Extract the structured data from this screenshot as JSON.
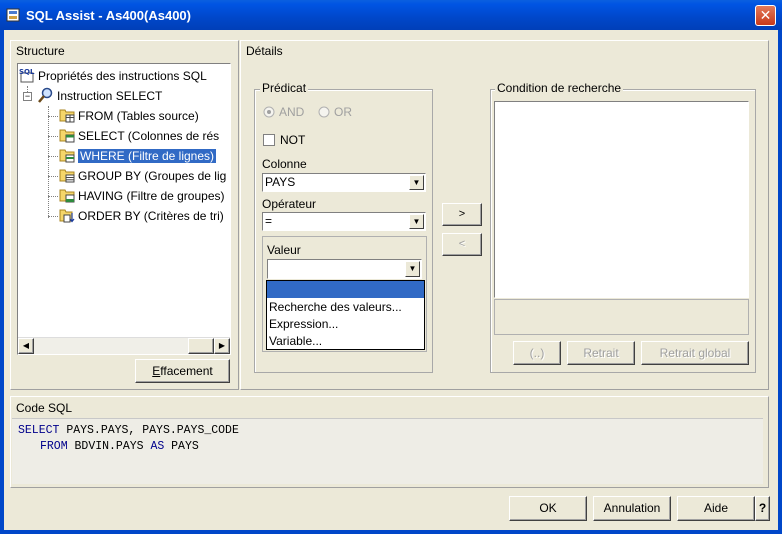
{
  "window": {
    "title": "SQL Assist - As400(As400)",
    "close_glyph": "✕"
  },
  "structure": {
    "label": "Structure",
    "tree": [
      {
        "label": "Propriétés des instructions SQL",
        "icon": "sql-icon"
      },
      {
        "label": "Instruction SELECT",
        "icon": "magnifier-icon"
      },
      {
        "label": "FROM (Tables source)",
        "icon": "folder-table-icon"
      },
      {
        "label": "SELECT (Colonnes de rés",
        "icon": "folder-table-icon"
      },
      {
        "label": "WHERE (Filtre de lignes)",
        "icon": "folder-table-icon"
      },
      {
        "label": "GROUP BY (Groupes de lig",
        "icon": "folder-table-icon"
      },
      {
        "label": "HAVING (Filtre de groupes)",
        "icon": "folder-table-icon"
      },
      {
        "label": "ORDER BY (Critères de tri)",
        "icon": "folder-sort-icon"
      }
    ],
    "clear_button": "Effacement",
    "clear_button_accel": "E",
    "clear_button_rest": "ffacement"
  },
  "details": {
    "label": "Détails",
    "predicat": {
      "label": "Prédicat",
      "and_label": "AND",
      "or_label": "OR",
      "not_label": "NOT",
      "column_label": "Colonne",
      "column_value": "PAYS",
      "operator_label": "Opérateur",
      "operator_value": "=",
      "value_label": "Valeur",
      "value_input": "",
      "value_options": [
        "",
        "Recherche des valeurs...",
        "Expression...",
        "Variable..."
      ]
    },
    "add_button": ">",
    "remove_button": "<",
    "search_condition": {
      "label": "Condition de recherche",
      "paren_button": "(..)",
      "retrait_button": "Retrait",
      "retrait_global_button": "Retrait global"
    }
  },
  "sql_code": {
    "label": "Code SQL",
    "line1_kw": "SELECT",
    "line1_rest": " PAYS.PAYS, PAYS.PAYS_CODE",
    "line2_kw": "FROM",
    "line2_mid": " BDVIN.PAYS ",
    "line2_kw2": "AS",
    "line2_rest": " PAYS"
  },
  "footer": {
    "ok": "OK",
    "cancel": "Annulation",
    "help": "Aide",
    "question": "?"
  },
  "colors": {
    "titlebar": "#0054e3",
    "selection": "#316ac5",
    "keyword": "#00008b",
    "dialog_bg": "#ece9d8"
  }
}
